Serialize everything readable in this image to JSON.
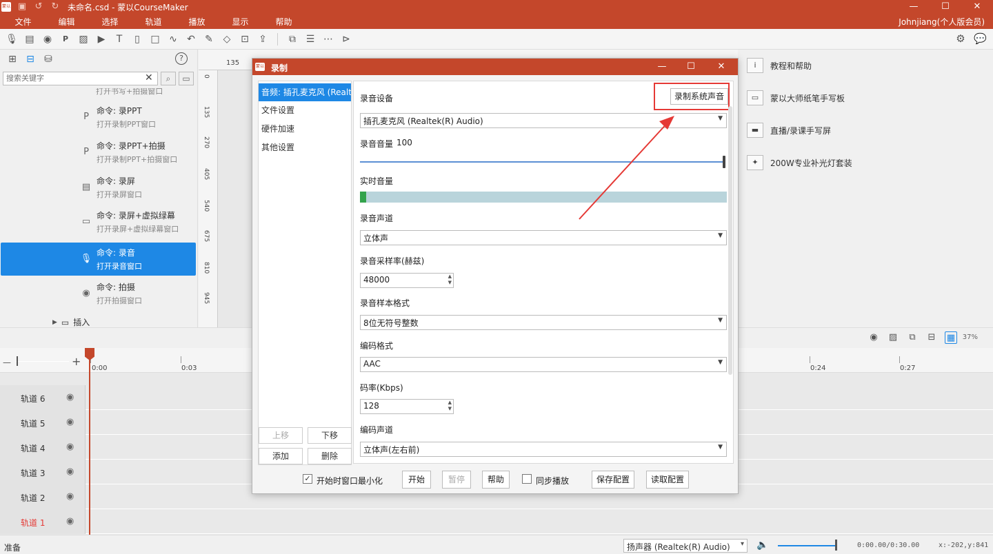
{
  "window": {
    "title": "未命名.csd - 蒙以CourseMaker",
    "logo_text": "蒙以",
    "minimize": "—",
    "maximize": "☐",
    "close": "✕"
  },
  "menubar": {
    "items": [
      "文件",
      "编辑",
      "选择",
      "轨道",
      "播放",
      "显示",
      "帮助"
    ],
    "user": "Johnjiang(个人版会员)"
  },
  "left_panel": {
    "search_placeholder": "搜索关键字",
    "partial_item": "打开书写+拍摄窗口",
    "items": [
      {
        "title": "命令: 录PPT",
        "desc": "打开录制PPT窗口"
      },
      {
        "title": "命令: 录PPT+拍摄",
        "desc": "打开录制PPT+拍摄窗口"
      },
      {
        "title": "命令: 录屏",
        "desc": "打开录屏窗口"
      },
      {
        "title": "命令: 录屏+虚拟绿幕",
        "desc": "打开录屏+虚拟绿幕窗口"
      },
      {
        "title": "命令: 录音",
        "desc": "打开录音窗口"
      },
      {
        "title": "命令: 拍摄",
        "desc": "打开拍摄窗口"
      }
    ],
    "folder": "插入"
  },
  "ruler": {
    "top_number": "135",
    "left_numbers": [
      "0",
      "135",
      "270",
      "405",
      "540",
      "675",
      "810",
      "945"
    ]
  },
  "right_panel": {
    "items": [
      {
        "label": "教程和帮助"
      },
      {
        "label": "蒙以大师纸笔手写板"
      },
      {
        "label": "直播/录课手写屏"
      },
      {
        "label": "200W专业补光灯套装"
      }
    ]
  },
  "timeline": {
    "zoom": "37%",
    "timecodes": [
      "0:00",
      "0:03",
      "0:24",
      "0:27"
    ],
    "tracks": [
      "轨道 6",
      "轨道 5",
      "轨道 4",
      "轨道 3",
      "轨道 2",
      "轨道 1"
    ]
  },
  "statusbar": {
    "status": "准备",
    "device": "扬声器 (Realtek(R) Audio)",
    "volume": 1.0,
    "time": "0:00.00/0:30.00",
    "coords": "x:-202,y:841"
  },
  "dialog": {
    "title": "录制",
    "nav": [
      "音频: 插孔麦克风 (Realtek(R) Audio)",
      "文件设置",
      "硬件加速",
      "其他设置"
    ],
    "move_up": "上移",
    "move_down": "下移",
    "add": "添加",
    "delete": "删除",
    "device_label": "录音设备",
    "sys_sound_button": "录制系统声音",
    "device_value": "插孔麦克风 (Realtek(R) Audio)",
    "volume_label": "录音音量",
    "volume_value": "100",
    "realtime_label": "实时音量",
    "realtime_level": 0.016,
    "channel_label": "录音声道",
    "channel_value": "立体声",
    "rate_label": "录音采样率(赫兹)",
    "rate_value": "48000",
    "format_label": "录音样本格式",
    "format_value": "8位无符号整数",
    "codec_label": "编码格式",
    "codec_value": "AAC",
    "bitrate_label": "码率(Kbps)",
    "bitrate_value": "128",
    "enc_channel_label": "编码声道",
    "enc_channel_value": "立体声(左右前)",
    "minimize_on_start": "开始时窗口最小化",
    "start": "开始",
    "pause": "暂停",
    "help": "帮助",
    "sync_play": "同步播放",
    "save_config": "保存配置",
    "load_config": "读取配置",
    "check_mark": "✓"
  },
  "colors": {
    "brand": "#c4472b",
    "accent": "#1e88e5",
    "highlight": "#e53935"
  }
}
